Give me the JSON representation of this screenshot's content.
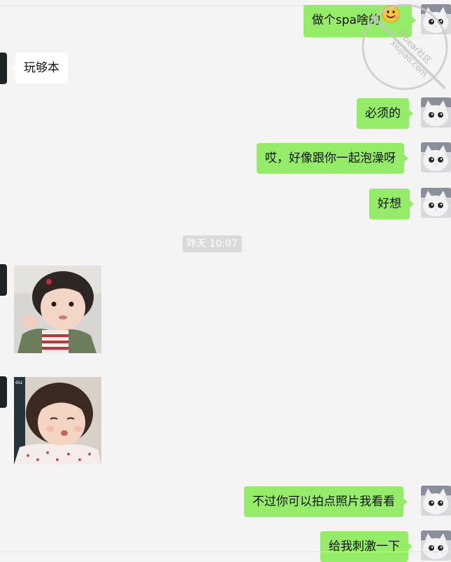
{
  "timestamp": "昨天 10:07",
  "watermark": {
    "text1": "ITbear社区",
    "text2": "xiujiao.com"
  },
  "messages": {
    "m1": "做个spa啥的",
    "m2": "玩够本",
    "m3": "必须的",
    "m4": "哎，好像跟你一起泡澡呀",
    "m5": "好想",
    "m6": "不过你可以拍点照片我看看",
    "m7": "给我刺激一下"
  },
  "stickers": {
    "s2_label": "ou"
  },
  "colors": {
    "sent_bubble": "#95ec69",
    "received_bubble": "#ffffff",
    "background": "#f4f4f4",
    "timestamp_bg": "#dadada"
  }
}
